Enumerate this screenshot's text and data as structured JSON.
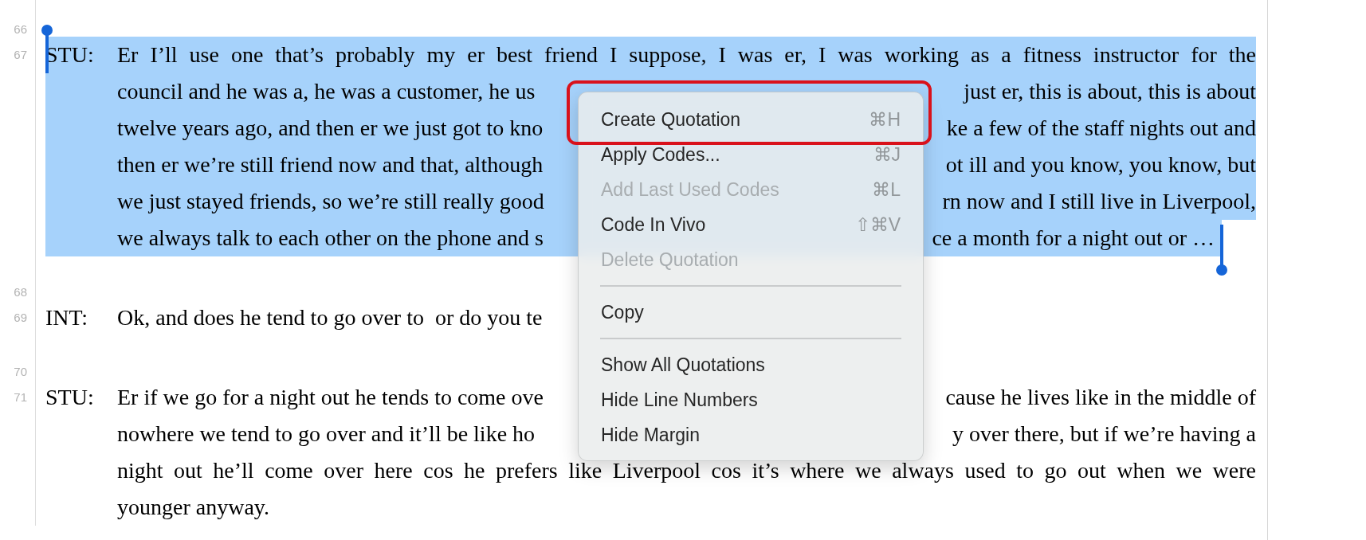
{
  "document": {
    "blocks": [
      {
        "kind": "blank",
        "line_number": "66"
      },
      {
        "kind": "turn",
        "line_number": "67",
        "speaker": "STU:",
        "selected": true,
        "lines": [
          {
            "kind": "full",
            "text": "Er I’ll use one that’s probably my er best friend I suppose, I was er, I was working as a fitness instructor for the"
          },
          {
            "kind": "split",
            "left": "council and he was a, he was a customer, he us",
            "right": "just er, this is about, this is about"
          },
          {
            "kind": "split",
            "left": "twelve years ago, and then er we just got to kno",
            "right": "ke a few of the staff nights out and"
          },
          {
            "kind": "split",
            "left": "then er we’re still friend now and that, although",
            "right": "ot ill and you know, you know, but"
          },
          {
            "kind": "split",
            "left": "we just stayed friends, so we’re still really good",
            "right": "rn now and I still live in Liverpool,"
          },
          {
            "kind": "split",
            "left": "we always talk to each other on the phone and s",
            "right": "ce a month for a night out or …"
          }
        ]
      },
      {
        "kind": "blank",
        "line_number": "68"
      },
      {
        "kind": "turn",
        "line_number": "69",
        "speaker": "INT:",
        "selected": false,
        "lines": [
          {
            "kind": "split",
            "left": "Ok, and does he tend to go over to  or do you te"
          }
        ]
      },
      {
        "kind": "blank",
        "line_number": "70"
      },
      {
        "kind": "turn",
        "line_number": "71",
        "speaker": "STU:",
        "selected": false,
        "lines": [
          {
            "kind": "split",
            "left": "Er if we go for a night out he tends to come ove",
            "right": "cause he lives like in the middle of"
          },
          {
            "kind": "split",
            "left": "nowhere we tend to go over and it’ll be like ho",
            "right": "y over there, but if we’re having a"
          },
          {
            "kind": "full",
            "text": "night out he’ll come over here cos he prefers like Liverpool cos it’s where we always used to go out when we were"
          },
          {
            "kind": "full",
            "text": "younger anyway."
          }
        ]
      }
    ]
  },
  "context_menu": {
    "items": [
      {
        "kind": "item",
        "label": "Create Quotation",
        "shortcut": "⌘H",
        "disabled": false,
        "framed": true
      },
      {
        "kind": "item",
        "label": "Apply Codes...",
        "shortcut": "⌘J",
        "disabled": false,
        "framed": false
      },
      {
        "kind": "item",
        "label": "Add Last Used Codes",
        "shortcut": "⌘L",
        "disabled": true,
        "framed": false
      },
      {
        "kind": "item",
        "label": "Code In Vivo",
        "shortcut": "⇧⌘V",
        "disabled": false,
        "framed": false
      },
      {
        "kind": "item",
        "label": "Delete Quotation",
        "disabled": true,
        "framed": false
      },
      {
        "kind": "separator"
      },
      {
        "kind": "item",
        "label": "Copy",
        "disabled": false,
        "framed": false
      },
      {
        "kind": "separator"
      },
      {
        "kind": "item",
        "label": "Show All Quotations",
        "disabled": false,
        "framed": false
      },
      {
        "kind": "item",
        "label": "Hide Line Numbers",
        "disabled": false,
        "framed": false
      },
      {
        "kind": "item",
        "label": "Hide Margin",
        "disabled": false,
        "framed": false
      }
    ]
  }
}
